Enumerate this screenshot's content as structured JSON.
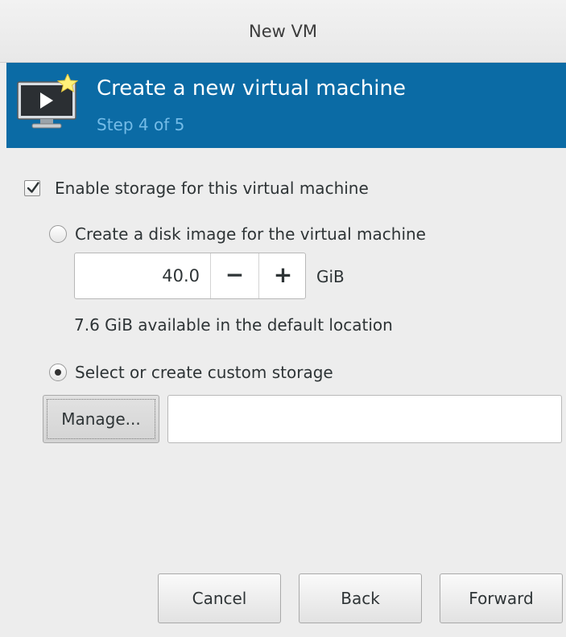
{
  "window": {
    "title": "New VM"
  },
  "banner": {
    "heading": "Create a new virtual machine",
    "step": "Step 4 of 5",
    "icon": "vm-monitor-icon",
    "background_color": "#0b6ba5"
  },
  "storage": {
    "enable_label": "Enable storage for this virtual machine",
    "enable_checked": true,
    "disk_image_label": "Create a disk image for the virtual machine",
    "disk_image_selected": false,
    "disk_size_value": "40.0",
    "decrement_label": "−",
    "increment_label": "+",
    "size_unit": "GiB",
    "available_text": "7.6 GiB available in the default location",
    "custom_storage_label": "Select or create custom storage",
    "custom_storage_selected": true,
    "manage_label": "Manage...",
    "path_value": "",
    "path_placeholder": ""
  },
  "footer": {
    "cancel_label": "Cancel",
    "back_label": "Back",
    "forward_label": "Forward"
  }
}
